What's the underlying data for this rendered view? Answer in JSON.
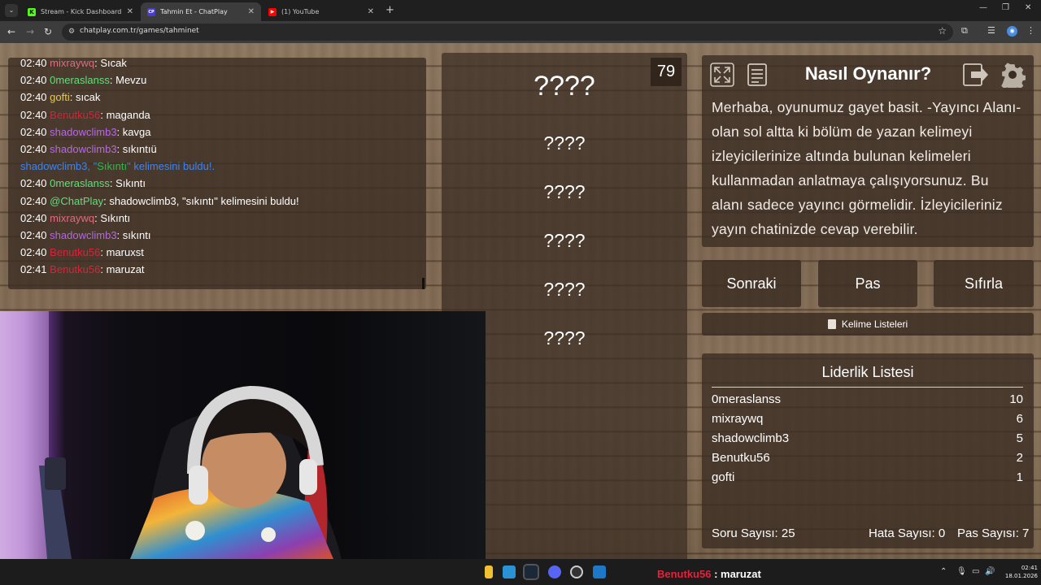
{
  "browser": {
    "tabs": [
      {
        "title": "Stream - Kick Dashboard",
        "favicon": "kick-icon",
        "color": "#53fc18",
        "letter": "K",
        "active": false
      },
      {
        "title": "Tahmin Et - ChatPlay",
        "favicon": "chatplay-icon",
        "color": "#6a4cff",
        "letter": "CP",
        "active": true
      },
      {
        "title": "(1) YouTube",
        "favicon": "youtube-icon",
        "color": "#ff0000",
        "letter": "▶",
        "active": false
      }
    ],
    "url": "chatplay.com.tr/games/tahminet"
  },
  "chat": {
    "lines": [
      {
        "time": "02:40",
        "user": "mixraywq",
        "color": "#e06a80",
        "sep": ": ",
        "msg": "Sıcak"
      },
      {
        "time": "02:40",
        "user": "0meraslanss",
        "color": "#5de07a",
        "sep": ": ",
        "msg": "Mevzu"
      },
      {
        "time": "02:40",
        "user": "gofti",
        "color": "#e8c94a",
        "sep": ": ",
        "msg": "sıcak"
      },
      {
        "time": "02:40",
        "user": "Benutku56",
        "color": "#d8233a",
        "sep": ": ",
        "msg": "maganda"
      },
      {
        "time": "02:40",
        "user": "shadowclimb3",
        "color": "#b568e6",
        "sep": ": ",
        "msg": "kavga"
      },
      {
        "time": "02:40",
        "user": "shadowclimb3",
        "color": "#b568e6",
        "sep": ": ",
        "msg": "sıkıntıü"
      },
      {
        "time": "",
        "user": "shadowclimb3,",
        "color": "#3b84f0",
        "sep": " ",
        "msg": "\"Sıkıntı\" kelimesini buldu!.",
        "msgcolor": "#3b84f0",
        "highlight": "Sıkıntı"
      },
      {
        "time": "02:40",
        "user": "0meraslanss",
        "color": "#5de07a",
        "sep": ": ",
        "msg": "Sıkıntı"
      },
      {
        "time": "02:40",
        "user": "@ChatPlay",
        "color": "#5de07a",
        "sep": ": ",
        "msg": "shadowclimb3, \"sıkıntı\" kelimesini buldu!"
      },
      {
        "time": "02:40",
        "user": "mixraywq",
        "color": "#e06a80",
        "sep": ": ",
        "msg": "Sıkıntı"
      },
      {
        "time": "02:40",
        "user": "shadowclimb3",
        "color": "#b568e6",
        "sep": ": ",
        "msg": "sıkıntı"
      },
      {
        "time": "02:40",
        "user": "Benutku56",
        "color": "#d8233a",
        "sep": ": ",
        "msg": "maruxst"
      },
      {
        "time": "02:41",
        "user": "Benutku56",
        "color": "#d8233a",
        "sep": ": ",
        "msg": "maruzat"
      }
    ]
  },
  "game": {
    "counter": "79",
    "words": [
      "????",
      "????",
      "????",
      "????",
      "????",
      "????"
    ],
    "help_title": "Nasıl Oynanır?",
    "help_text": "Merhaba, oyunumuz gayet basit. -Yayıncı Alanı- olan sol altta ki bölüm de yazan kelimeyi izleyicilerinize altında bulunan kelimeleri kullanmadan anlatmaya çalışıyorsunuz. Bu alanı sadece yayıncı görmelidir. İzleyicileriniz yayın chatinizde cevap verebilir.",
    "buttons": {
      "next": "Sonraki",
      "pass": "Pas",
      "reset": "Sıfırla"
    },
    "word_lists": "Kelime Listeleri",
    "leaderboard_title": "Liderlik Listesi",
    "leaderboard": [
      {
        "name": "0meraslanss",
        "score": "10"
      },
      {
        "name": "mixraywq",
        "score": "6"
      },
      {
        "name": "shadowclimb3",
        "score": "5"
      },
      {
        "name": "Benutku56",
        "score": "2"
      },
      {
        "name": "gofti",
        "score": "1"
      }
    ],
    "stats": {
      "questions": "Soru Sayısı: 25",
      "errors": "Hata Sayısı: 0",
      "passes": "Pas Sayısı: 7"
    }
  },
  "taskbar": {
    "ticker_user": "Benutku56",
    "ticker_msg": " : maruzat",
    "time": "02:41",
    "date": "18.01.2026"
  }
}
